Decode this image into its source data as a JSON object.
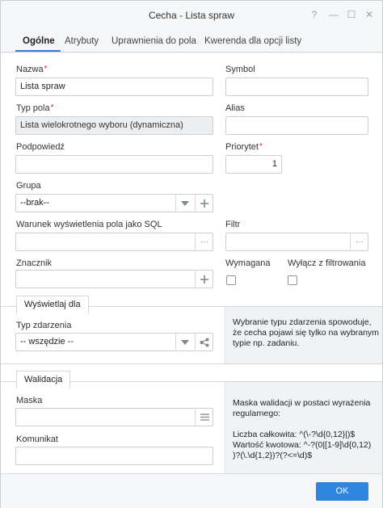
{
  "window": {
    "title": "Cecha - Lista spraw",
    "help_icon": "?",
    "minimize_icon": "—",
    "maximize_icon": "☐",
    "close_icon": "✕"
  },
  "tabs": [
    {
      "label": "Ogólne",
      "active": true
    },
    {
      "label": "Atrybuty"
    },
    {
      "label": "Uprawnienia do pola"
    },
    {
      "label": "Kwerenda dla opcji listy"
    }
  ],
  "form": {
    "nazwa": {
      "label": "Nazwa",
      "value": "Lista spraw",
      "required": "*"
    },
    "symbol": {
      "label": "Symbol",
      "value": ""
    },
    "typ_pola": {
      "label": "Typ pola",
      "value": "Lista wielokrotnego wyboru (dynamiczna)",
      "required": "*"
    },
    "alias": {
      "label": "Alias",
      "value": ""
    },
    "podpowiedz": {
      "label": "Podpowiedź",
      "value": ""
    },
    "priorytet": {
      "label": "Priorytet",
      "value": "1",
      "required": "*"
    },
    "grupa": {
      "label": "Grupa",
      "value": "--brak--"
    },
    "warunek": {
      "label": "Warunek wyświetlenia pola jako SQL",
      "value": ""
    },
    "filtr": {
      "label": "Filtr",
      "value": ""
    },
    "znacznik": {
      "label": "Znacznik",
      "value": ""
    },
    "wymagana": {
      "label": "Wymagana",
      "checked": false
    },
    "wylacz": {
      "label": "Wyłącz z filtrowania",
      "checked": false
    }
  },
  "wyswietlaj": {
    "section_label": "Wyświetlaj dla",
    "typ_zdarzenia_label": "Typ zdarzenia",
    "typ_zdarzenia_value": "-- wszędzie --",
    "info": [
      "Wybranie typu zdarzenia spowoduje,",
      "że cecha pojawi się tylko na wybranym",
      "typie np. zadaniu."
    ]
  },
  "walidacja": {
    "section_label": "Walidacja",
    "maska_label": "Maska",
    "maska_value": "",
    "komunikat_label": "Komunikat",
    "komunikat_value": "",
    "info": [
      "Maska walidacji w postaci wyrażenia",
      "regularnego:",
      "",
      "Liczba całkowita: ^(\\-?\\d{0,12}|)$",
      "Wartość kwotowa: ^-?(0|[1-9]\\d{0,12)",
      ")?(\\.\\d{1,2})?(?<=\\d)$"
    ]
  },
  "footer": {
    "ok_label": "OK"
  },
  "icons": {
    "dropdown": "chevron-down-icon",
    "plus": "plus-icon",
    "ellipsis": "ellipsis-icon",
    "share": "share-icon",
    "list": "list-icon"
  },
  "colors": {
    "accent": "#2f84e0",
    "required": "#d9262f"
  }
}
